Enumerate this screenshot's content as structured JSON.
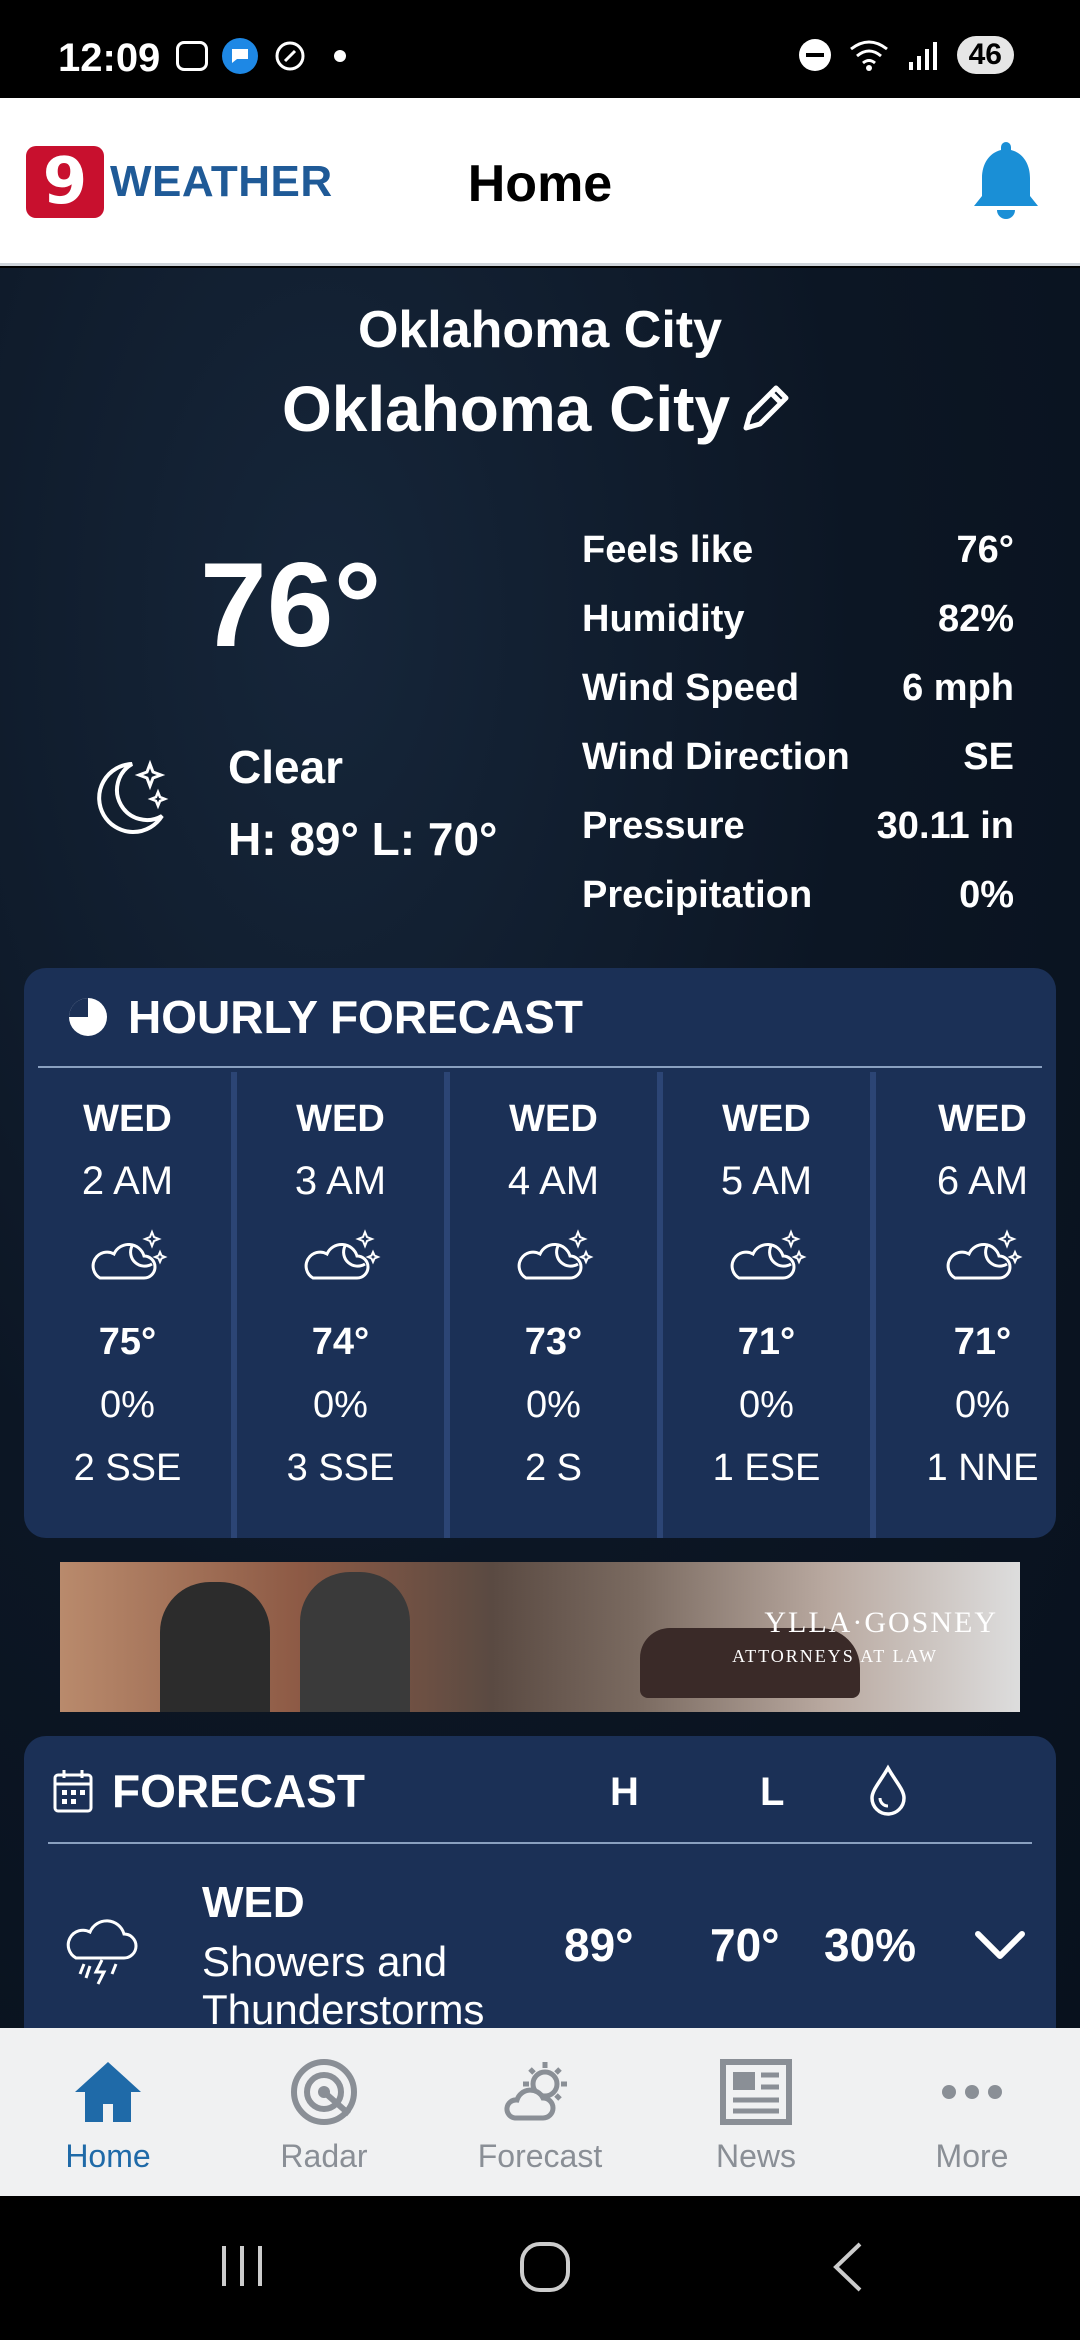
{
  "status_bar": {
    "time": "12:09",
    "battery": "46"
  },
  "header": {
    "logo_number": "9",
    "logo_text": "WEATHER",
    "title": "Home"
  },
  "current": {
    "location_label": "Oklahoma City",
    "location_name": "Oklahoma City",
    "temperature": "76°",
    "condition": "Clear",
    "high_low": "H: 89° L: 70°",
    "details": [
      {
        "label": "Feels like",
        "value": "76°"
      },
      {
        "label": "Humidity",
        "value": "82%"
      },
      {
        "label": "Wind Speed",
        "value": "6 mph"
      },
      {
        "label": "Wind Direction",
        "value": "SE"
      },
      {
        "label": "Pressure",
        "value": "30.11 in"
      },
      {
        "label": "Precipitation",
        "value": "0%"
      }
    ]
  },
  "hourly": {
    "title": "HOURLY FORECAST",
    "items": [
      {
        "day": "WED",
        "time": "2 AM",
        "icon": "cloudy-night-icon",
        "temp": "75°",
        "pop": "0%",
        "wind": "2 SSE"
      },
      {
        "day": "WED",
        "time": "3 AM",
        "icon": "cloudy-night-icon",
        "temp": "74°",
        "pop": "0%",
        "wind": "3 SSE"
      },
      {
        "day": "WED",
        "time": "4 AM",
        "icon": "cloudy-night-icon",
        "temp": "73°",
        "pop": "0%",
        "wind": "2 S"
      },
      {
        "day": "WED",
        "time": "5 AM",
        "icon": "cloudy-night-icon",
        "temp": "71°",
        "pop": "0%",
        "wind": "1 ESE"
      },
      {
        "day": "WED",
        "time": "6 AM",
        "icon": "cloudy-night-icon",
        "temp": "71°",
        "pop": "0%",
        "wind": "1 NNE"
      }
    ]
  },
  "ad": {
    "brand": "YLLA·GOSNEY",
    "tagline": "ATTORNEYS AT LAW"
  },
  "forecast": {
    "title": "FORECAST",
    "col_high": "H",
    "col_low": "L",
    "rows": [
      {
        "day": "WED",
        "description": "Showers and Thunderstorms",
        "high": "89°",
        "low": "70°",
        "pop": "30%"
      }
    ]
  },
  "nav": {
    "items": [
      {
        "label": "Home",
        "icon": "home-icon"
      },
      {
        "label": "Radar",
        "icon": "radar-icon"
      },
      {
        "label": "Forecast",
        "icon": "forecast-icon"
      },
      {
        "label": "News",
        "icon": "news-icon"
      },
      {
        "label": "More",
        "icon": "more-icon"
      }
    ]
  },
  "colors": {
    "header_bg": "#ffffff",
    "brand_red": "#c8102e",
    "brand_blue": "#1f5a97",
    "card_bg": "#1b3056",
    "nav_active": "#1f6aa8"
  }
}
